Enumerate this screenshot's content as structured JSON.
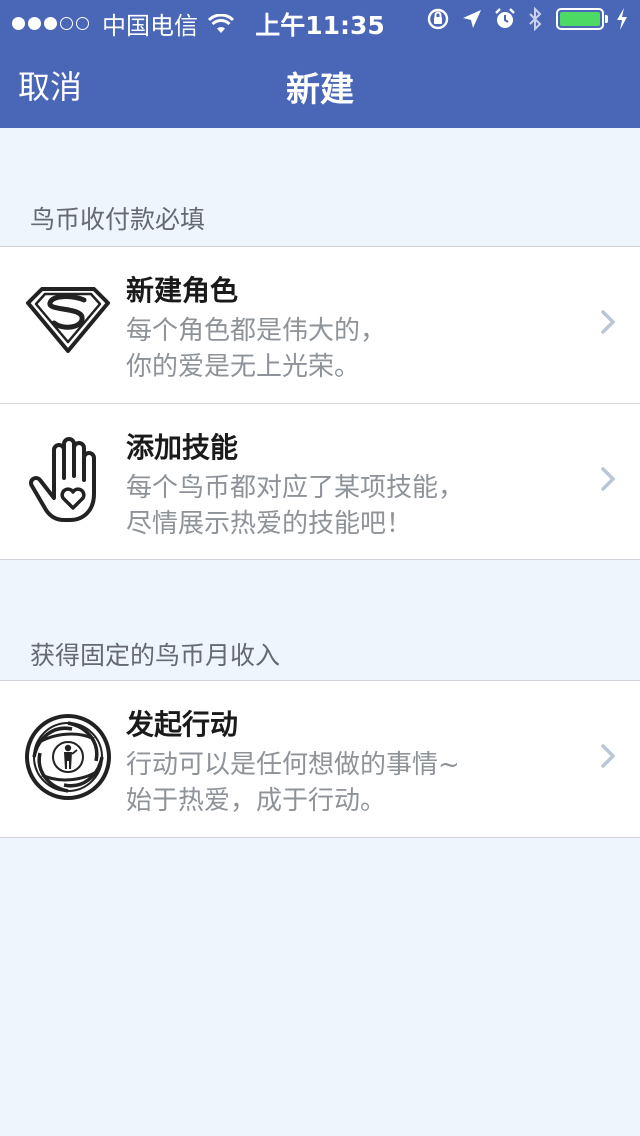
{
  "status_bar": {
    "carrier": "中国电信",
    "time": "上午11:35"
  },
  "nav": {
    "cancel_label": "取消",
    "title": "新建"
  },
  "sections": [
    {
      "header": "鸟币收付款必填",
      "items": [
        {
          "title": "新建角色",
          "desc_line1": "每个角色都是伟大的，",
          "desc_line2": "你的爱是无上光荣。",
          "icon": "superman-shield-icon"
        },
        {
          "title": "添加技能",
          "desc_line1": "每个鸟币都对应了某项技能，",
          "desc_line2": "尽情展示热爱的技能吧！",
          "icon": "hand-heart-icon"
        }
      ]
    },
    {
      "header": "获得固定的鸟币月收入",
      "items": [
        {
          "title": "发起行动",
          "desc_line1": "行动可以是任何想做的事情~",
          "desc_line2": "始于热爱，成于行动。",
          "icon": "spy-gunbarrel-icon"
        }
      ]
    }
  ],
  "colors": {
    "nav_background": "#4966b7",
    "page_background": "#eef5fd",
    "battery_fill": "#4cd964",
    "chevron": "#b9c6d6"
  }
}
